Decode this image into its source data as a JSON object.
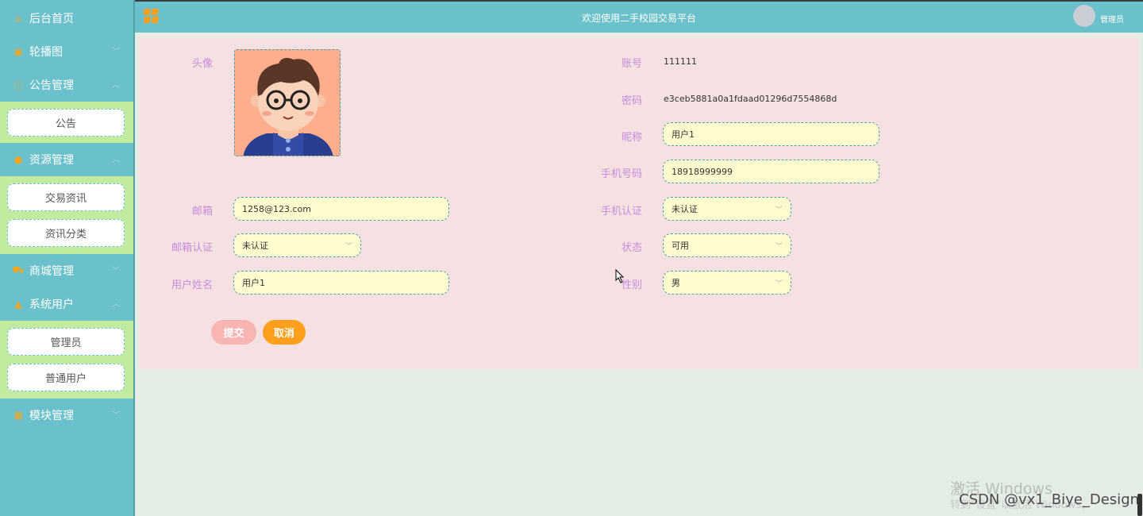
{
  "header": {
    "title": "欢迎使用二手校园交易平台",
    "user_label": "管理员"
  },
  "sidebar": {
    "items": [
      {
        "label": "后台首页",
        "icon": "home-icon"
      },
      {
        "label": "轮播图",
        "icon": "image-icon"
      },
      {
        "label": "公告管理",
        "icon": "info-icon"
      },
      {
        "label": "资源管理",
        "icon": "resource-icon"
      },
      {
        "label": "商城管理",
        "icon": "cart-icon"
      },
      {
        "label": "系统用户",
        "icon": "user-icon"
      },
      {
        "label": "模块管理",
        "icon": "grid-icon"
      }
    ],
    "sub_notice": [
      "公告"
    ],
    "sub_resource": [
      "交易资讯",
      "资讯分类"
    ],
    "sub_user": [
      "管理员",
      "普通用户"
    ]
  },
  "form": {
    "avatar_label": "头像",
    "account_label": "账号",
    "account_value": "111111",
    "password_label": "密码",
    "password_value": "e3ceb5881a0a1fdaad01296d7554868d",
    "nickname_label": "昵称",
    "nickname_value": "用户1",
    "phone_label": "手机号码",
    "phone_value": "18918999999",
    "email_label": "邮箱",
    "email_value": "1258@123.com",
    "phone_verify_label": "手机认证",
    "phone_verify_value": "未认证",
    "email_verify_label": "邮箱认证",
    "email_verify_value": "未认证",
    "status_label": "状态",
    "status_value": "可用",
    "realname_label": "用户姓名",
    "realname_value": "用户1",
    "gender_label": "性别",
    "gender_value": "男",
    "submit_label": "提交",
    "cancel_label": "取消"
  },
  "watermark": {
    "activate": "激活 Windows",
    "activate_sub": "转到\"设置\"以激活 Windows。",
    "credit": "CSDN @vx1_Biye_Design"
  },
  "colors": {
    "sidebar_bg": "#6bc1cb",
    "submenu_bg": "#c3eb9f",
    "panel_bg": "#f6e1e2",
    "input_bg": "#fffbcf",
    "label_color": "#c58cdc",
    "accent_orange": "#ff9f1c",
    "submit_pink": "#f9b4b4"
  }
}
